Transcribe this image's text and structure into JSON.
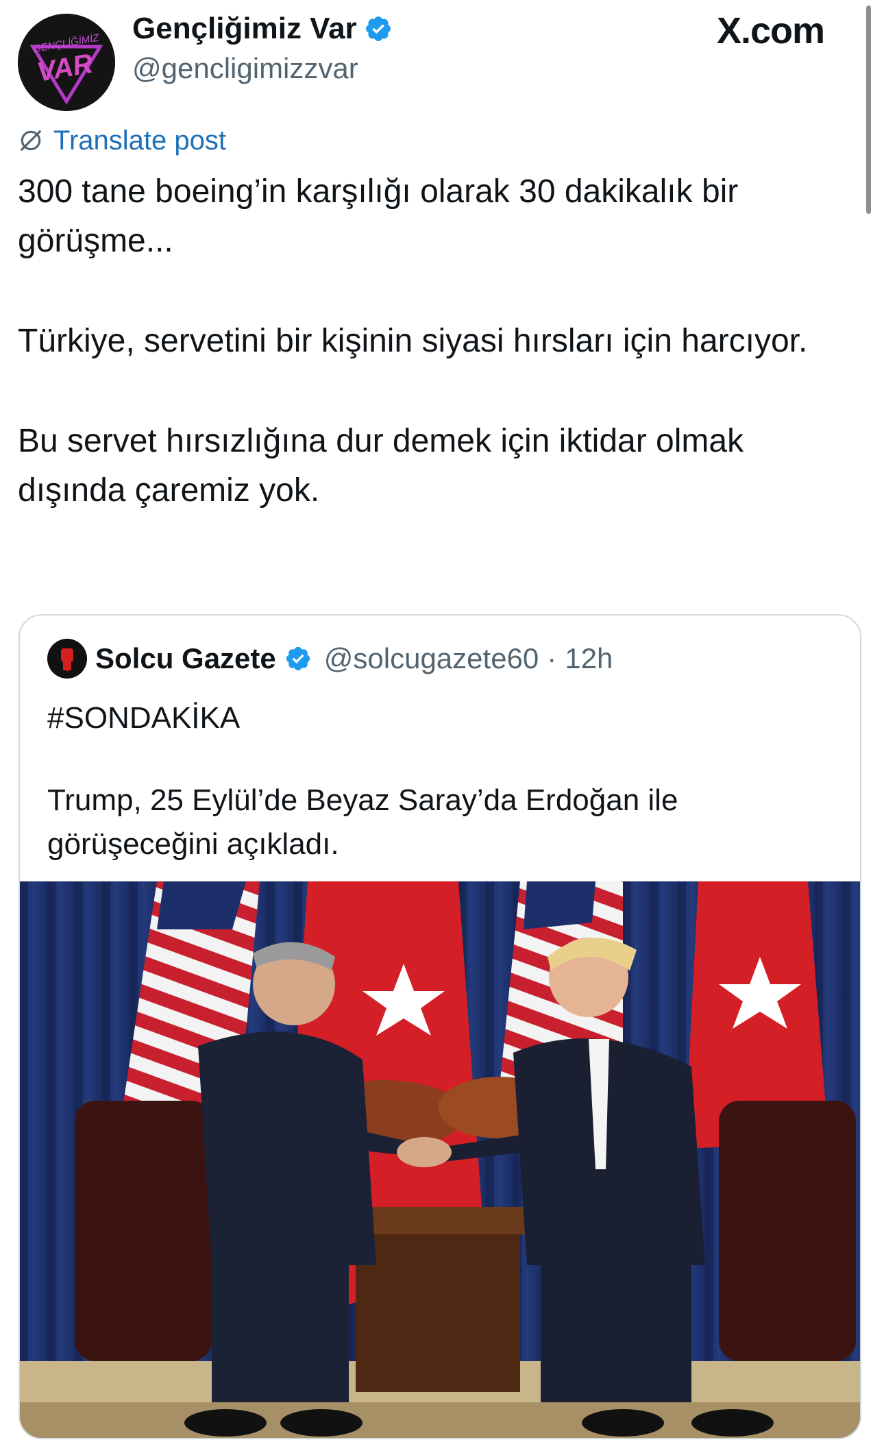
{
  "author": {
    "name": "Gençliğimiz Var",
    "handle": "@gencligimizzvar",
    "avatar_text": "VAR",
    "avatar_top_text": "GENÇLİĞİMİZ"
  },
  "site_label": "X.com",
  "translate_label": "Translate post",
  "post": {
    "paragraphs": [
      "300 tane boeing’in karşılığı olarak 30 dakikalık bir görüşme...",
      "Türkiye, servetini bir kişinin siyasi hırsları için harcıyor.",
      "Bu servet hırsızlığına dur demek için iktidar olmak dışında çaremiz yok."
    ]
  },
  "quote": {
    "name": "Solcu Gazete",
    "handle": "@solcugazete60",
    "separator": "·",
    "time": "12h",
    "paragraphs": [
      "#SONDAKİKA",
      "Trump, 25 Eylül’de Beyaz Saray’da Erdoğan ile görüşeceğini açıkladı."
    ]
  },
  "colors": {
    "verified": "#1d9bf0",
    "link": "#1d6fb8",
    "secondary_text": "#536471",
    "border": "#cfd9de"
  },
  "icons": {
    "verified": "verified-badge-icon",
    "translate": "globe-slash-icon"
  }
}
